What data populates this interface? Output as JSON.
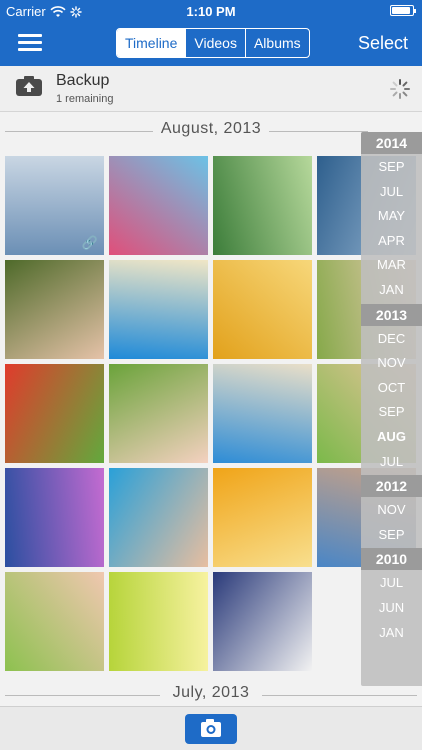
{
  "status": {
    "carrier": "Carrier",
    "time": "1:10 PM",
    "battery_level": 0.9
  },
  "nav": {
    "tabs": [
      {
        "label": "Timeline",
        "active": true
      },
      {
        "label": "Videos",
        "active": false
      },
      {
        "label": "Albums",
        "active": false
      }
    ],
    "select_label": "Select"
  },
  "backup": {
    "title": "Backup",
    "subtitle": "1 remaining"
  },
  "sections": [
    {
      "title": "August, 2013"
    },
    {
      "title": "July, 2013"
    }
  ],
  "index": [
    {
      "label": "2014",
      "kind": "year"
    },
    {
      "label": "SEP",
      "kind": "month"
    },
    {
      "label": "JUL",
      "kind": "month"
    },
    {
      "label": "MAY",
      "kind": "month"
    },
    {
      "label": "APR",
      "kind": "month"
    },
    {
      "label": "MAR",
      "kind": "month"
    },
    {
      "label": "JAN",
      "kind": "month"
    },
    {
      "label": "2013",
      "kind": "year"
    },
    {
      "label": "DEC",
      "kind": "month"
    },
    {
      "label": "NOV",
      "kind": "month"
    },
    {
      "label": "OCT",
      "kind": "month"
    },
    {
      "label": "SEP",
      "kind": "month"
    },
    {
      "label": "AUG",
      "kind": "month",
      "current": true
    },
    {
      "label": "JUL",
      "kind": "month"
    },
    {
      "label": "2012",
      "kind": "year"
    },
    {
      "label": "NOV",
      "kind": "month"
    },
    {
      "label": "SEP",
      "kind": "month"
    },
    {
      "label": "2010",
      "kind": "year"
    },
    {
      "label": "JUL",
      "kind": "month"
    },
    {
      "label": "JUN",
      "kind": "month"
    },
    {
      "label": "JAN",
      "kind": "month"
    }
  ],
  "photos": [
    {
      "name": "city-river-photo",
      "c1": "#6b8fb5",
      "c2": "#c9d6e3",
      "linked": true
    },
    {
      "name": "cupcakes-photo",
      "c1": "#e04f7a",
      "c2": "#6cc2e6"
    },
    {
      "name": "waterfall-photo",
      "c1": "#3c7d3a",
      "c2": "#b6d89b"
    },
    {
      "name": "lake-photo",
      "c1": "#2e5f8d",
      "c2": "#9ab8d4"
    },
    {
      "name": "woman-phone-photo",
      "c1": "#4e6a2a",
      "c2": "#e5c2a8"
    },
    {
      "name": "beach-ball-photo",
      "c1": "#1f8ad8",
      "c2": "#f0e6c6"
    },
    {
      "name": "girl-tablet-photo",
      "c1": "#e2a11b",
      "c2": "#f7d77a"
    },
    {
      "name": "woman-lying-photo",
      "c1": "#86a94a",
      "c2": "#e9cdb4"
    },
    {
      "name": "tulips-photo",
      "c1": "#e03b2c",
      "c2": "#62a93d"
    },
    {
      "name": "girl-watermelon-photo",
      "c1": "#6aa33a",
      "c2": "#f4d1c0"
    },
    {
      "name": "ocean-beach-photo",
      "c1": "#2d8cd6",
      "c2": "#eadfc8"
    },
    {
      "name": "kids-goggles-photo",
      "c1": "#7bb94a",
      "c2": "#e9c49c"
    },
    {
      "name": "coral-reef-photo",
      "c1": "#2b4fa0",
      "c2": "#c46bd1"
    },
    {
      "name": "couple-photo",
      "c1": "#2aa0d8",
      "c2": "#e7bea0"
    },
    {
      "name": "autumn-leaves-photo",
      "c1": "#f0a418",
      "c2": "#f8df8e"
    },
    {
      "name": "boy-smile-photo",
      "c1": "#4a86c6",
      "c2": "#caa286"
    },
    {
      "name": "sisters-photo",
      "c1": "#8dc14f",
      "c2": "#f0c7b0"
    },
    {
      "name": "flower-meadow-photo",
      "c1": "#b6d43a",
      "c2": "#f7f2a0"
    },
    {
      "name": "graduate-photo",
      "c1": "#2a3a7a",
      "c2": "#f2f2f2"
    }
  ],
  "colors": {
    "brand": "#1e6bc7"
  },
  "icons": {
    "menu": "hamburger-icon",
    "backup": "camera-upload-icon",
    "spinner": "loading-spinner-icon",
    "camera": "camera-icon"
  }
}
